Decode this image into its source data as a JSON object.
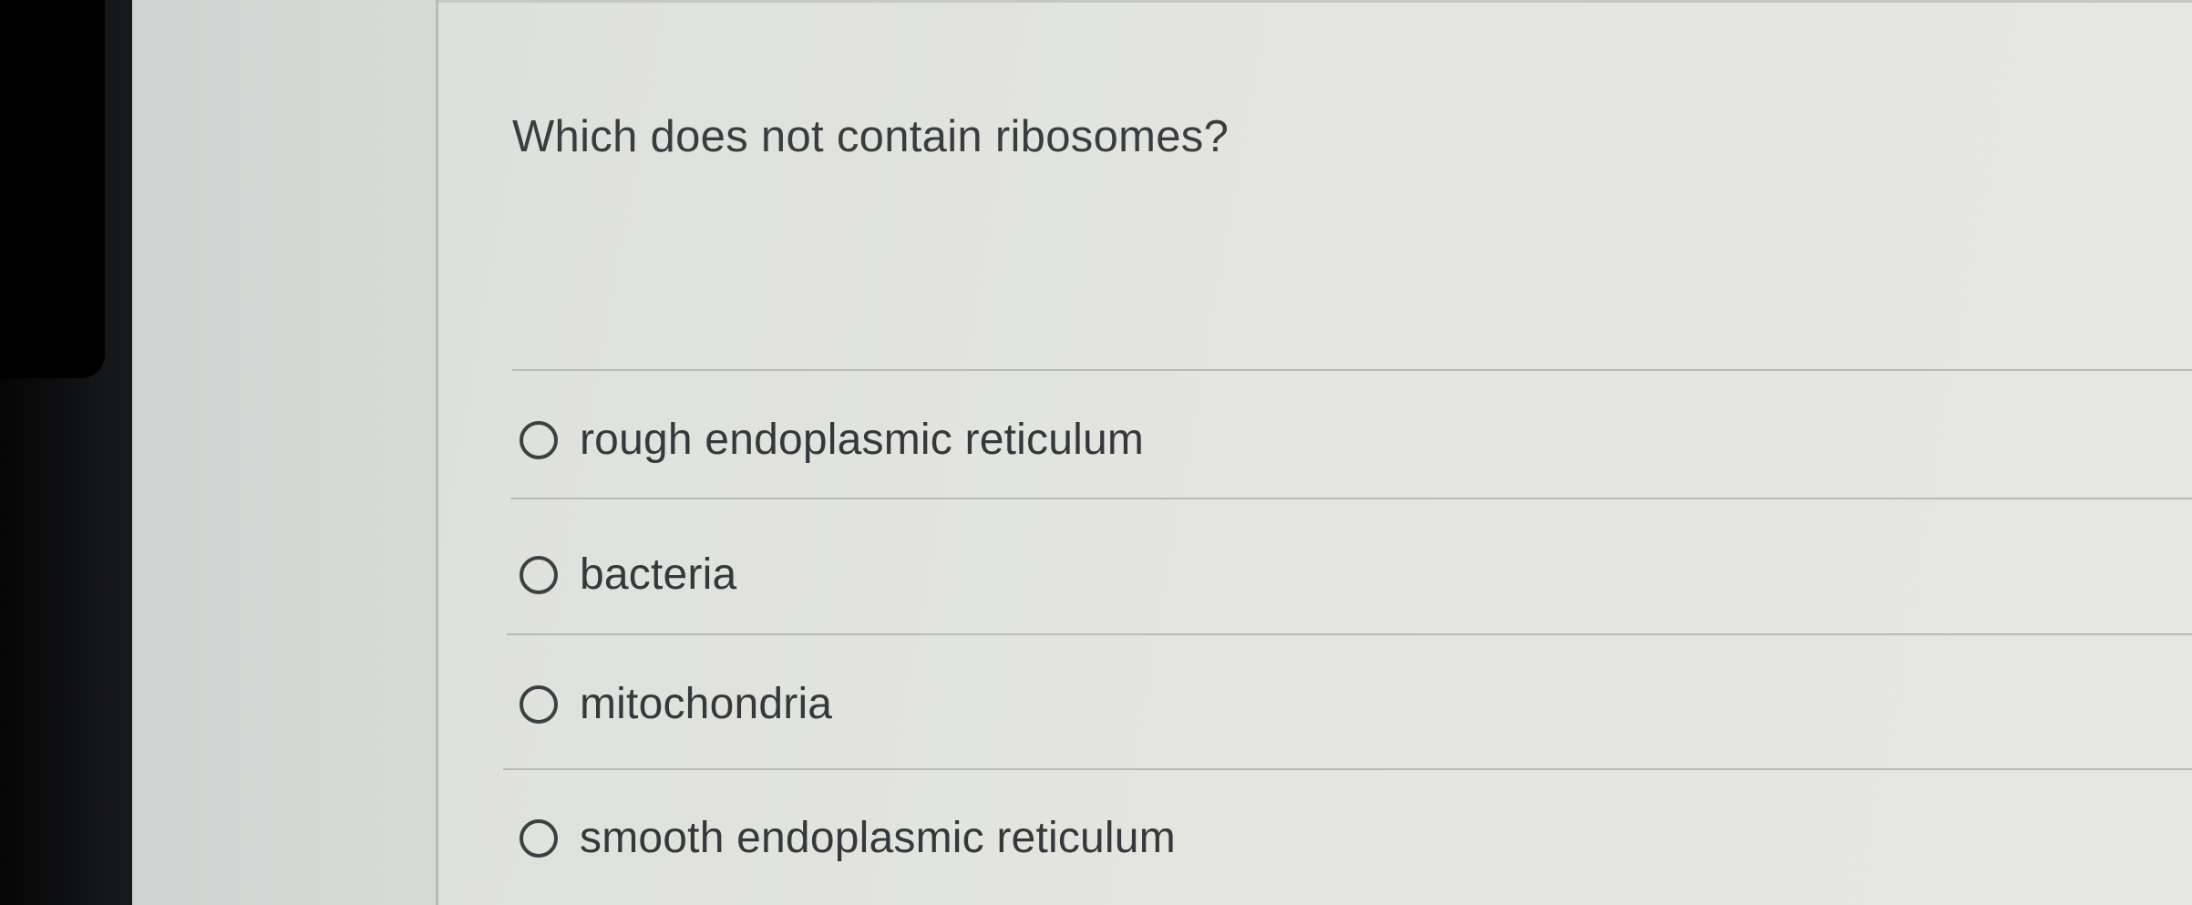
{
  "question": {
    "text": "Which does not contain ribosomes?"
  },
  "options": [
    {
      "label": "rough endoplasmic reticulum",
      "selected": false
    },
    {
      "label": "bacteria",
      "selected": false
    },
    {
      "label": "mitochondria",
      "selected": false
    },
    {
      "label": "smooth endoplasmic reticulum",
      "selected": false
    }
  ]
}
